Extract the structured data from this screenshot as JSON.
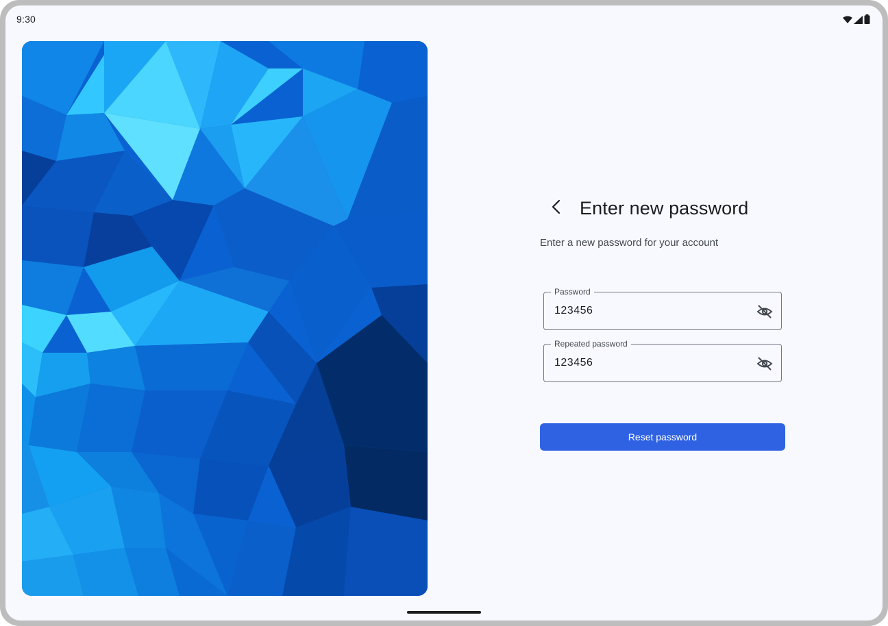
{
  "status_bar": {
    "time": "9:30",
    "icons": [
      "wifi-icon",
      "cellular-signal-icon",
      "battery-icon"
    ]
  },
  "hero": {
    "image": "blue-low-poly-background",
    "colors": [
      "#1fb6ff",
      "#0a78e0",
      "#0550b8",
      "#022c66"
    ]
  },
  "header": {
    "back_icon": "chevron-left-icon",
    "title": "Enter new password",
    "subtitle": "Enter a new password for your account"
  },
  "form": {
    "password": {
      "label": "Password",
      "value": "123456",
      "toggle_icon": "eye-off-icon"
    },
    "repeated_password": {
      "label": "Repeated password",
      "value": "123456",
      "toggle_icon": "eye-off-icon"
    },
    "submit_label": "Reset password"
  },
  "theme": {
    "accent": "#2f62e3",
    "background": "#f7f9ff",
    "outline": "#73777f"
  }
}
